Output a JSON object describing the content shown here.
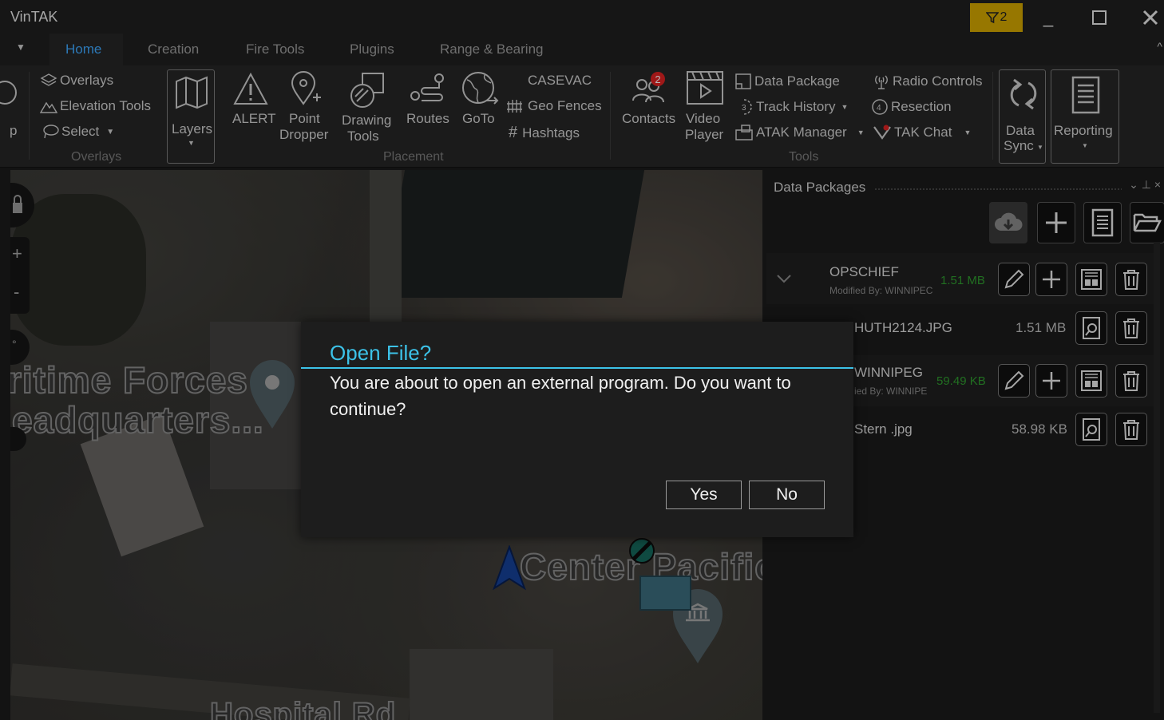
{
  "app": {
    "title": "VinTAK"
  },
  "titlebar": {
    "filter_count": "2"
  },
  "tabs": [
    {
      "label": "Home",
      "active": true
    },
    {
      "label": "Creation"
    },
    {
      "label": "Fire Tools"
    },
    {
      "label": "Plugins"
    },
    {
      "label": "Range & Bearing"
    }
  ],
  "ribbon": {
    "overlays_group": {
      "label": "Overlays",
      "items": [
        "Overlays",
        "Elevation Tools",
        "Select"
      ],
      "left_clip": "p"
    },
    "layers": "Layers",
    "placement_group": {
      "label": "Placement",
      "alert": "ALERT",
      "point_dropper": [
        "Point",
        "Dropper"
      ],
      "drawing_tools": [
        "Drawing",
        "Tools"
      ],
      "routes": "Routes",
      "goto": "GoTo",
      "casevac": "CASEVAC",
      "geo_fences": "Geo Fences",
      "hashtags": "Hashtags"
    },
    "tools_group": {
      "label": "Tools",
      "contacts": "Contacts",
      "contacts_badge": "2",
      "video_player": [
        "Video",
        "Player"
      ],
      "data_package": "Data Package",
      "track_history": "Track History",
      "atak_manager": "ATAK Manager",
      "radio_controls": "Radio Controls",
      "resection": "Resection",
      "tak_chat": "TAK Chat"
    },
    "data_sync": [
      "Data",
      "Sync"
    ],
    "reporting": "Reporting"
  },
  "map": {
    "labels": [
      "ritime Forces",
      "eadquarters...",
      "Center Pacific",
      "Hospital Rd"
    ]
  },
  "panel": {
    "title": "Data Packages",
    "packages": [
      {
        "name": "OPSCHIEF",
        "modified": "Modified By: WINNIPEC",
        "size": "1.51 MB",
        "files": [
          {
            "name": "HUTH2124.JPG",
            "size": "1.51 MB"
          }
        ]
      },
      {
        "name": "WINNIPEG",
        "modified": "ied By: WINNIPE",
        "size": "59.49 KB",
        "files": [
          {
            "name": "Stern .jpg",
            "size": "58.98 KB"
          }
        ]
      }
    ]
  },
  "dialog": {
    "title": "Open File?",
    "message": "You are about to open an external program. Do you want to continue?",
    "yes": "Yes",
    "no": "No"
  },
  "colors": {
    "accent": "#3ea8ff",
    "dialog_accent": "#3cc2e8",
    "filter_badge": "#d2a600",
    "size_green": "#2e9a2e",
    "badge_red": "#dd2222"
  }
}
